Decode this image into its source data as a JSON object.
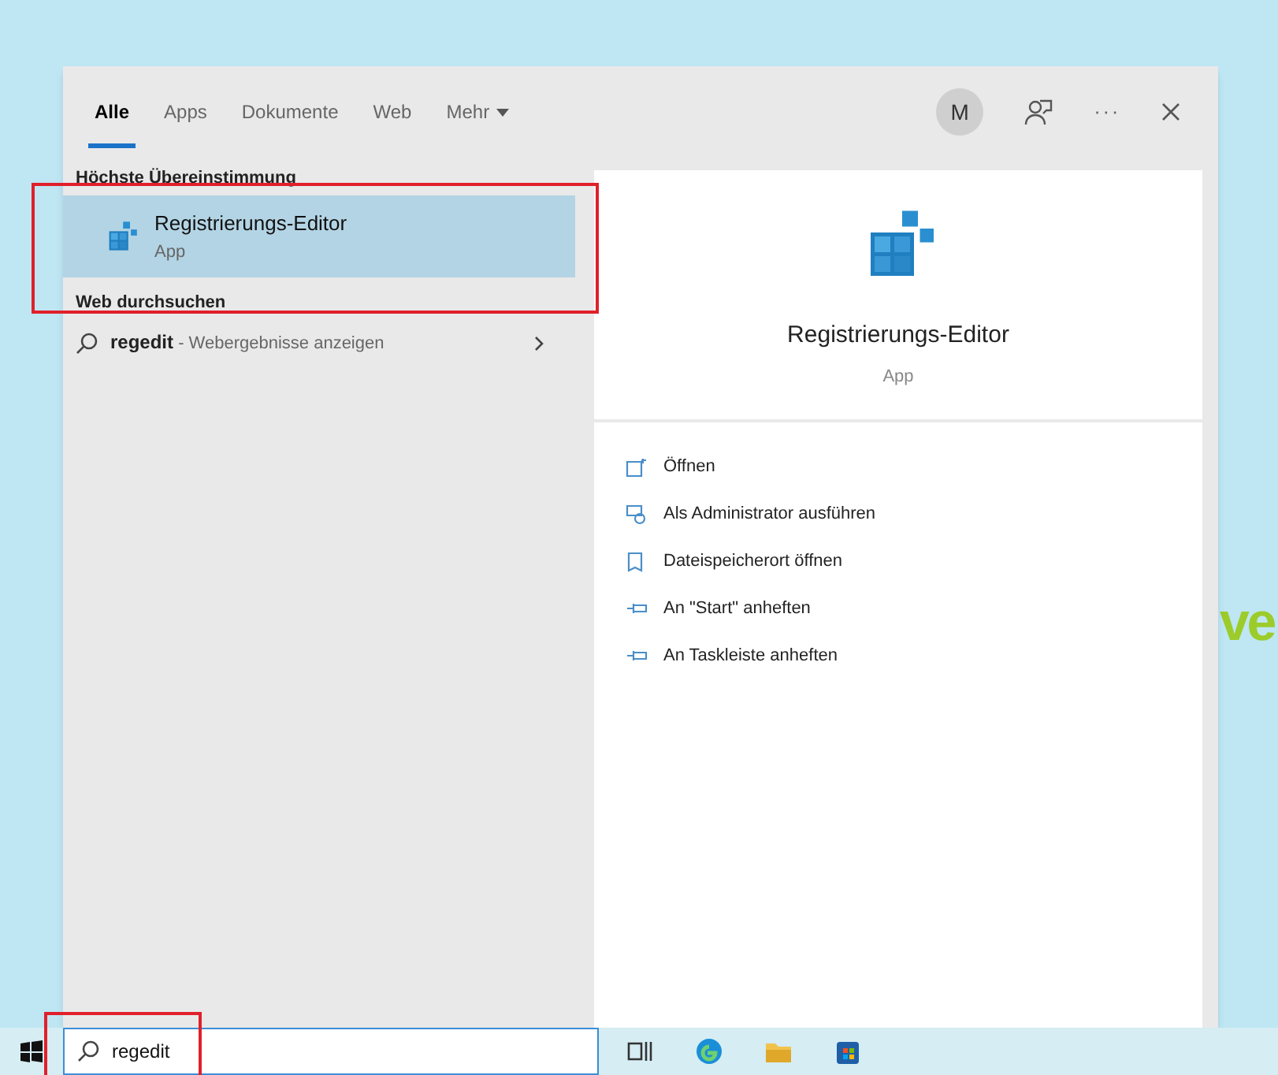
{
  "tabs": [
    {
      "label": "Alle",
      "selected": true
    },
    {
      "label": "Apps",
      "selected": false
    },
    {
      "label": "Dokumente",
      "selected": false
    },
    {
      "label": "Web",
      "selected": false
    },
    {
      "label": "Mehr",
      "selected": false,
      "dropdown": true
    }
  ],
  "header": {
    "avatar": "M",
    "more": "···"
  },
  "results": {
    "best_match_heading": "Höchste Übereinstimmung",
    "best_match": {
      "title": "Registrierungs-Editor",
      "subtitle": "App",
      "selected": true
    },
    "web_heading": "Web durchsuchen",
    "web_item": {
      "query": "regedit",
      "suffix": " - Webergebnisse anzeigen"
    }
  },
  "detail": {
    "title": "Registrierungs-Editor",
    "subtitle": "App",
    "actions": [
      {
        "kind": "open",
        "label": "Öffnen"
      },
      {
        "kind": "admin",
        "label": "Als Administrator ausführen"
      },
      {
        "kind": "location",
        "label": "Dateispeicherort öffnen"
      },
      {
        "kind": "pin",
        "label": "An \"Start\" anheften"
      },
      {
        "kind": "pin",
        "label": "An Taskleiste anheften"
      }
    ]
  },
  "taskbar": {
    "search_value": "regedit"
  },
  "wallpaper_text": "ve"
}
